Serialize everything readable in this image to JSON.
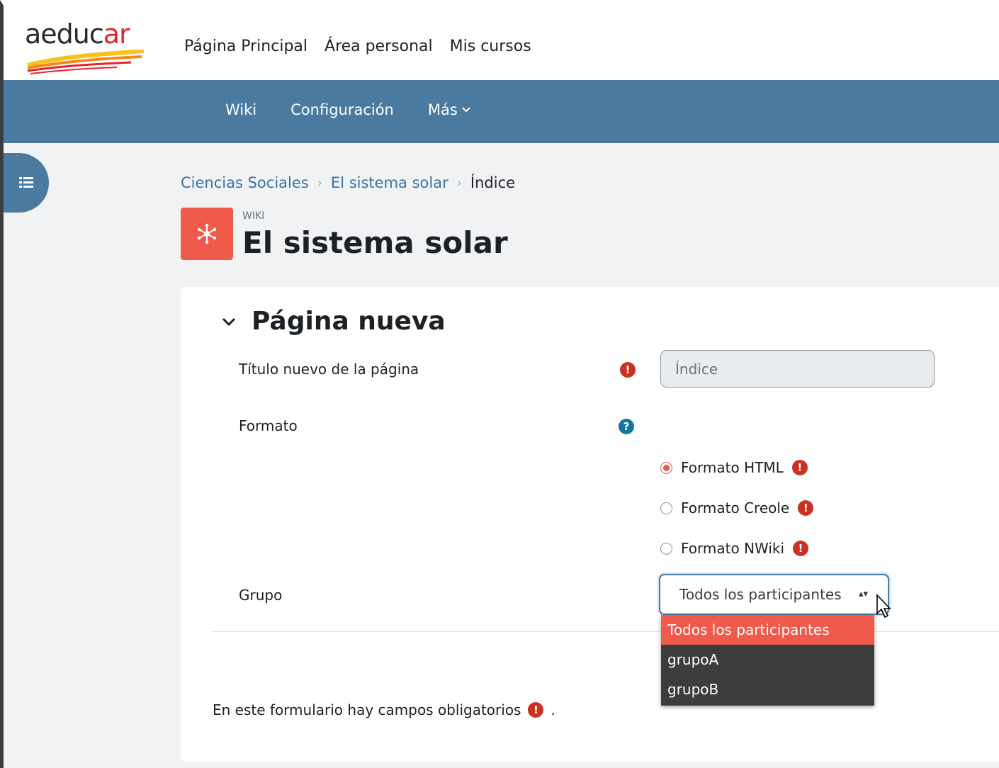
{
  "brand": {
    "logo_main": "aeduc",
    "logo_accent": "ar"
  },
  "primary_nav": [
    "Página Principal",
    "Área personal",
    "Mis cursos"
  ],
  "secondary_nav": {
    "wiki": "Wiki",
    "config": "Configuración",
    "more": "Más"
  },
  "breadcrumb": {
    "course": "Ciencias Sociales",
    "activity": "El sistema solar",
    "current": "Índice"
  },
  "activity": {
    "type_label": "WIKI",
    "title": "El sistema solar"
  },
  "form": {
    "section_title": "Página nueva",
    "title_label": "Título nuevo de la página",
    "title_value": "Índice",
    "format_label": "Formato",
    "formats": [
      {
        "label": "Formato HTML",
        "checked": true
      },
      {
        "label": "Formato Creole",
        "checked": false
      },
      {
        "label": "Formato NWiki",
        "checked": false
      }
    ],
    "group_label": "Grupo",
    "group_selected": "Todos los participantes",
    "group_options": [
      "Todos los participantes",
      "grupoA",
      "grupoB"
    ],
    "required_note": "En este formulario hay campos obligatorios",
    "required_note_end": "."
  },
  "icons": {
    "required": "!",
    "help": "?"
  },
  "colors": {
    "nav_blue": "#4a7aa0",
    "accent": "#f05a4b",
    "required": "#ca3120",
    "help": "#1177a1"
  }
}
